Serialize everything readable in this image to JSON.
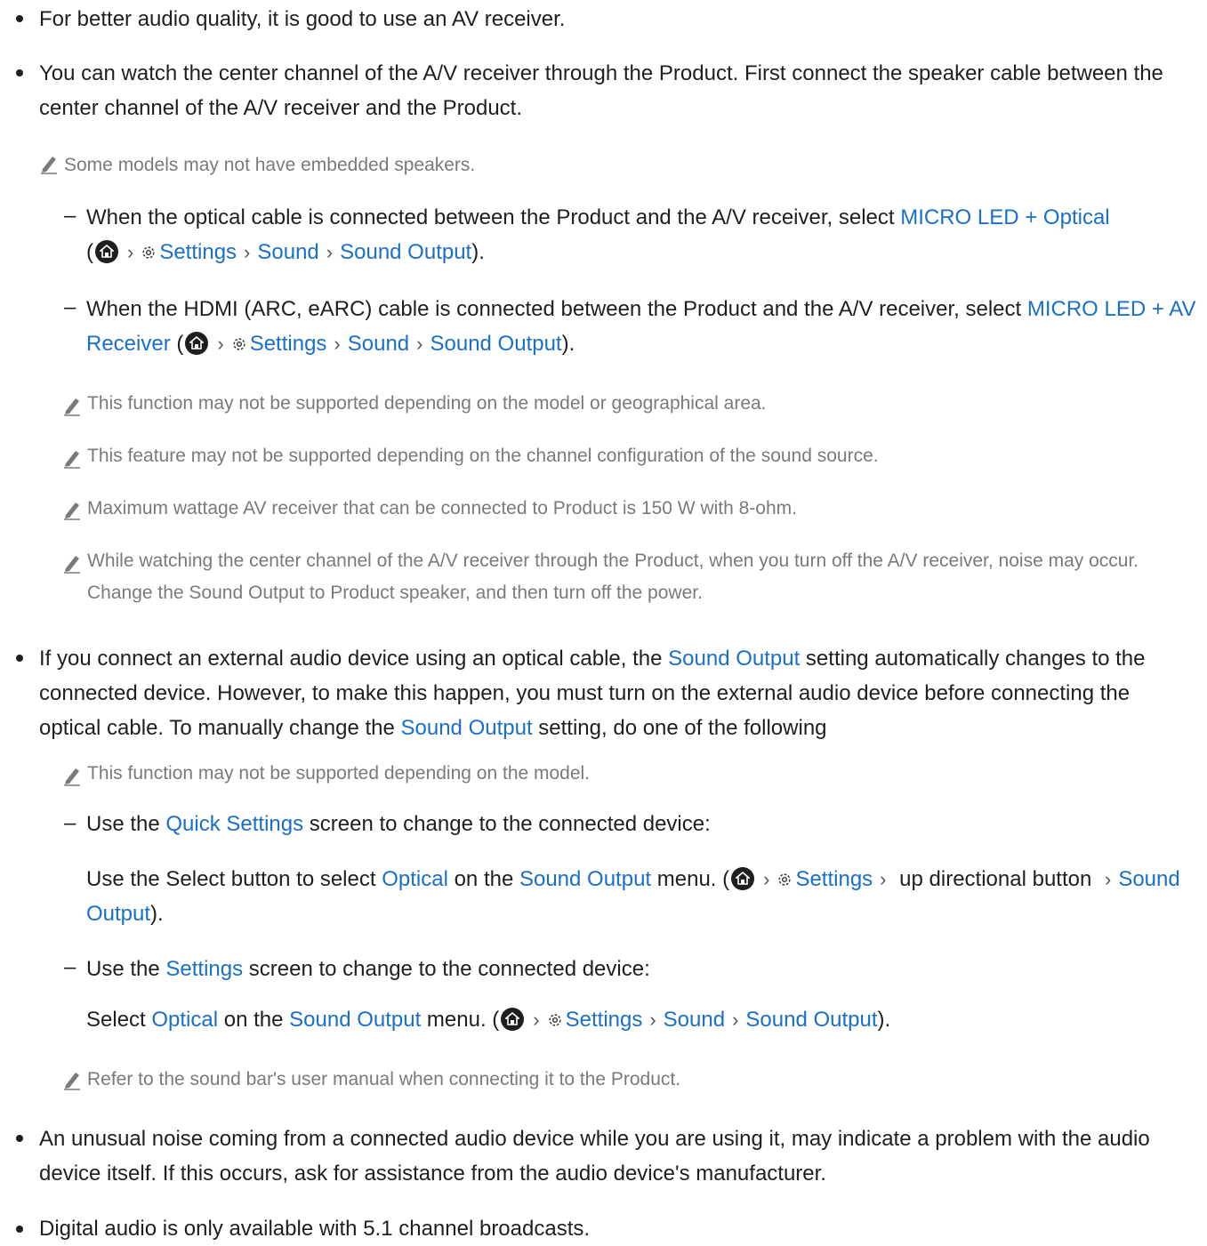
{
  "items": {
    "b1": "For better audio quality, it is good to use an AV receiver.",
    "b2": "You can watch the center channel of the A/V receiver through the Product. First connect the speaker cable between the center channel of the A/V receiver and the Product.",
    "n1": "Some models may not have embedded speakers.",
    "d1_pre": "When the optical cable is connected between the Product and the A/V receiver, select ",
    "d1_link": "MICRO LED + Optical",
    "d2_pre": "When the HDMI (ARC, eARC) cable is connected between the Product and the A/V receiver, select ",
    "d2_link": "MICRO LED + AV Receiver",
    "n2": "This function may not be supported depending on the model or geographical area.",
    "n3": "This feature may not be supported depending on the channel configuration of the sound source.",
    "n4": "Maximum wattage AV receiver that can be connected to Product is 150 W with 8-ohm.",
    "n5": "While watching the center channel of the A/V receiver through the Product, when you turn off the A/V receiver, noise may occur. Change the Sound Output to Product speaker, and then turn off the power.",
    "b3_a": "If you connect an external audio device using an optical cable, the ",
    "b3_link1": "Sound Output",
    "b3_b": " setting automatically changes to the connected device. However, to make this happen, you must turn on the external audio device before connecting the optical cable. To manually change the ",
    "b3_link2": "Sound Output",
    "b3_c": " setting, do one of the following",
    "n6": "This function may not be supported depending on the model.",
    "d3_a": "Use the ",
    "d3_link": "Quick Settings",
    "d3_b": " screen to change to the connected device:",
    "p3_a": "Use the Select button to select ",
    "p3_link1": "Optical",
    "p3_b": " on the ",
    "p3_link2": "Sound Output",
    "p3_c": " menu. (",
    "p3_d": " up directional button ",
    "p3_link3": "Sound Output",
    "p3_e": ").",
    "d4_a": "Use the ",
    "d4_link": "Settings",
    "d4_b": " screen to change to the connected device:",
    "p4_a": "Select ",
    "p4_link1": "Optical",
    "p4_b": " on the ",
    "p4_link2": "Sound Output",
    "p4_c": " menu. (",
    "n7": "Refer to the sound bar's user manual when connecting it to the Product.",
    "b4": "An unusual noise coming from a connected audio device while you are using it, may indicate a problem with the audio device itself. If this occurs, ask for assistance from the audio device's manufacturer.",
    "b5": "Digital audio is only available with 5.1 channel broadcasts."
  },
  "path": {
    "settings": "Settings",
    "sound": "Sound",
    "sound_output": "Sound Output",
    "open": " (",
    "close": ")."
  },
  "icons": {
    "home": "home-icon",
    "settings": "gear-icon",
    "note": "pencil-note-icon",
    "separator": "chevron-right-icon"
  },
  "colors": {
    "link": "#1a6fc7",
    "note_text": "#7a7a7a",
    "body_text": "#1f1f1f"
  }
}
